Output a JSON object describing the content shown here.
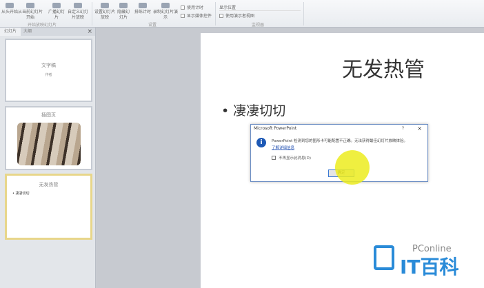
{
  "ribbon": {
    "buttons": [
      "从头开始",
      "从当前幻灯片开始",
      "广播幻灯片",
      "自定义幻灯片放映",
      "设置幻灯片放映",
      "隐藏幻灯片",
      "排练计时",
      "录制幻灯片演示"
    ],
    "checks": [
      "使用计时",
      "显示媒体控件",
      "显示位置",
      "使用演示者视图"
    ],
    "groups": [
      "开始放映幻灯片",
      "设置",
      "监视器"
    ]
  },
  "panel": {
    "tabs": [
      "幻灯片",
      "大纲"
    ],
    "close": "×",
    "slides": [
      {
        "title": "文字稿",
        "sub": "作者"
      },
      {
        "title": "插图页"
      },
      {
        "title": "无发热管",
        "bullet": "• 凄凄切切"
      }
    ]
  },
  "slide": {
    "title": "无发热管",
    "bullet": "• 凄凄切切"
  },
  "dialog": {
    "title": "Microsoft PowerPoint",
    "help": "?",
    "close": "×",
    "icon": "i",
    "message": "PowerPoint 检测到您的图形卡可能配置不正确。无法获得最佳幻灯片放映体验。",
    "link": "了解详细信息",
    "checkbox": "不再显示此消息(D)",
    "ok": "确定"
  },
  "watermark": {
    "brand": "PConline",
    "name": "IT百科"
  }
}
